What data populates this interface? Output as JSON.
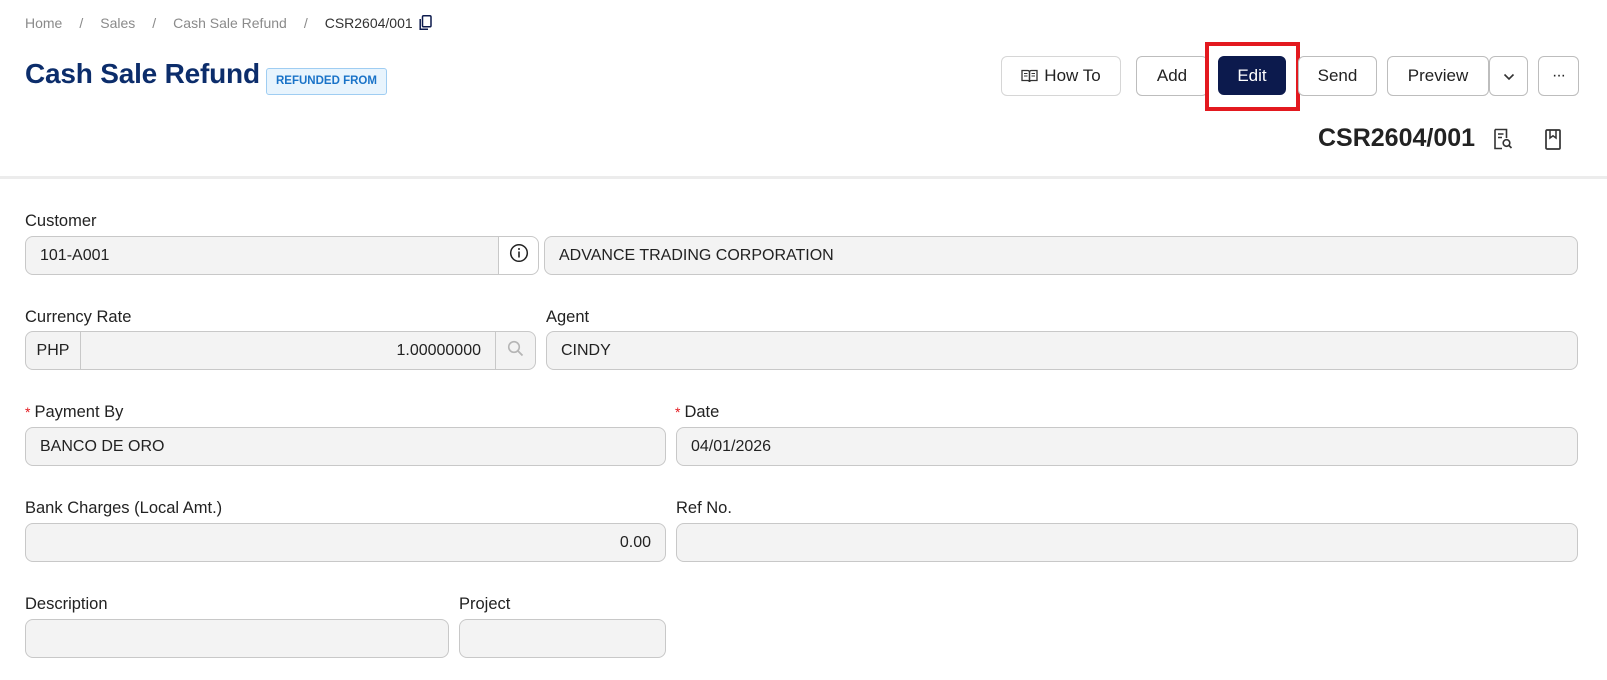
{
  "breadcrumb": {
    "home": "Home",
    "sales": "Sales",
    "section": "Cash Sale Refund",
    "current": "CSR2604/001",
    "sep": "/"
  },
  "header": {
    "title": "Cash Sale Refund",
    "badge": "REFUNDED FROM",
    "doc_number": "CSR2604/001"
  },
  "toolbar": {
    "how_to": "How To",
    "add": "Add",
    "edit": "Edit",
    "send": "Send",
    "preview": "Preview",
    "more": "···"
  },
  "form": {
    "customer_label": "Customer",
    "customer_code": "101-A001",
    "customer_name": "ADVANCE TRADING CORPORATION",
    "currency_rate_label": "Currency Rate",
    "currency_code": "PHP",
    "currency_rate": "1.00000000",
    "agent_label": "Agent",
    "agent": "CINDY",
    "payment_by_label": "Payment By",
    "payment_by": "BANCO DE ORO",
    "date_label": "Date",
    "date": "04/01/2026",
    "bank_charges_label": "Bank Charges (Local Amt.)",
    "bank_charges": "0.00",
    "ref_no_label": "Ref No.",
    "ref_no": "",
    "description_label": "Description",
    "description": "",
    "project_label": "Project",
    "project": "",
    "required_mark": "*"
  },
  "colors": {
    "title": "#0c2d6b",
    "edit_button": "#0c1a4d",
    "highlight": "#e3191f",
    "badge_text": "#1a73c8",
    "field_bg": "#f3f3f3"
  }
}
